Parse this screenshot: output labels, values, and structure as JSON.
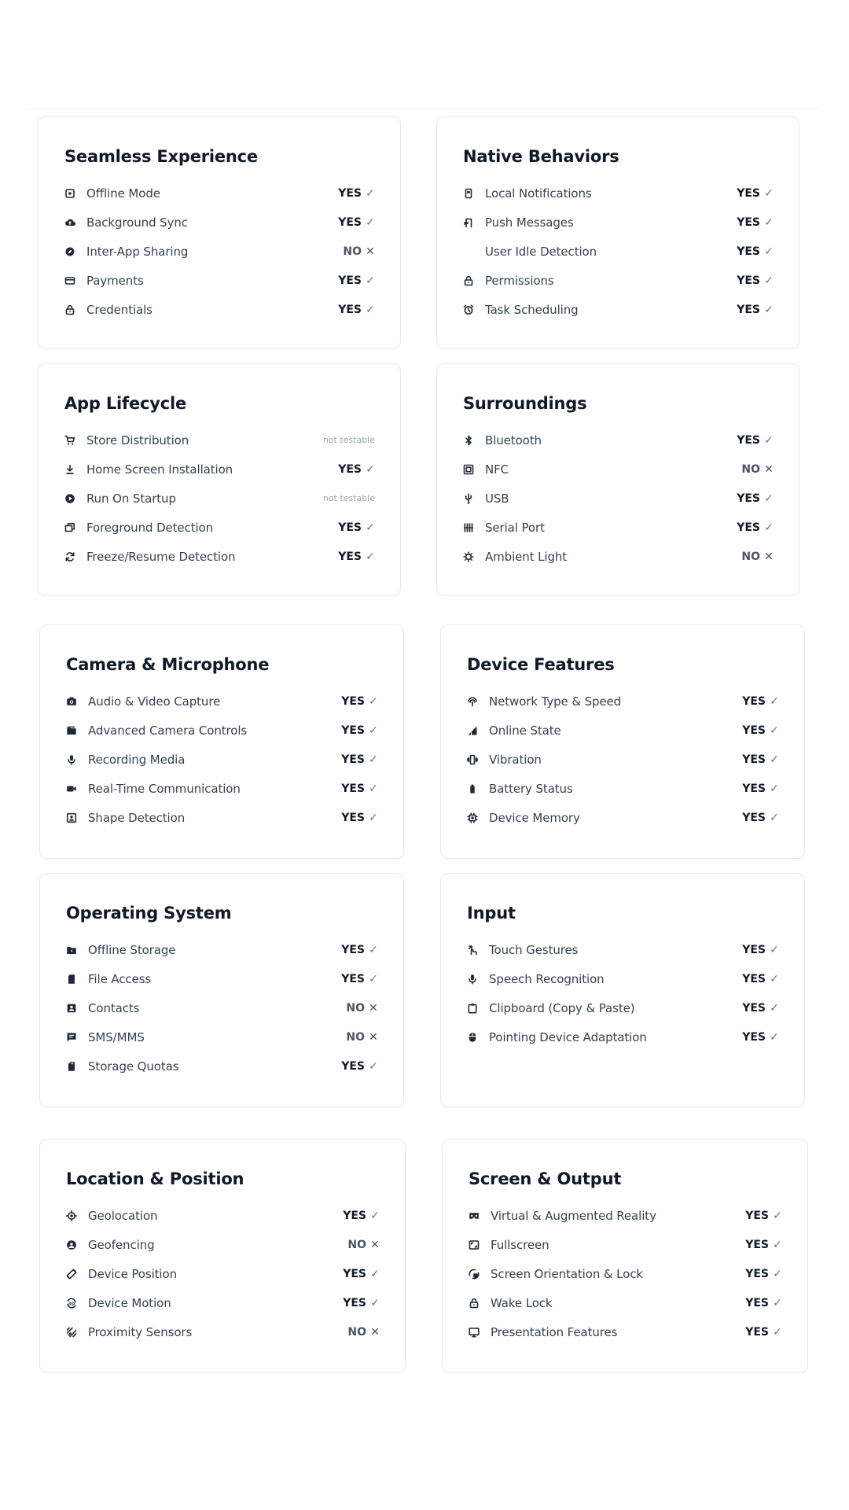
{
  "cards": [
    {
      "title": "Seamless Experience",
      "items": [
        {
          "label": "Offline Mode",
          "icon": "offline-mode-icon",
          "status": "YES",
          "mark": "✓"
        },
        {
          "label": "Background Sync",
          "icon": "cloud-sync-icon",
          "status": "YES",
          "mark": "✓"
        },
        {
          "label": "Inter-App Sharing",
          "icon": "share-compass-icon",
          "status": "NO",
          "mark": "✕"
        },
        {
          "label": "Payments",
          "icon": "credit-card-icon",
          "status": "YES",
          "mark": "✓"
        },
        {
          "label": "Credentials",
          "icon": "lock-icon",
          "status": "YES",
          "mark": "✓"
        }
      ]
    },
    {
      "title": "Native Behaviors",
      "items": [
        {
          "label": "Local Notifications",
          "icon": "phone-notification-icon",
          "status": "YES",
          "mark": "✓"
        },
        {
          "label": "Push Messages",
          "icon": "push-message-icon",
          "status": "YES",
          "mark": "✓"
        },
        {
          "label": "User Idle Detection",
          "icon": "moon-icon",
          "status": "YES",
          "mark": "✓"
        },
        {
          "label": "Permissions",
          "icon": "lock-icon",
          "status": "YES",
          "mark": "✓"
        },
        {
          "label": "Task Scheduling",
          "icon": "alarm-clock-icon",
          "status": "YES",
          "mark": "✓"
        }
      ]
    },
    {
      "title": "App Lifecycle",
      "items": [
        {
          "label": "Store Distribution",
          "icon": "shopping-cart-icon",
          "status": "not testable",
          "mark": ""
        },
        {
          "label": "Home Screen Installation",
          "icon": "download-icon",
          "status": "YES",
          "mark": "✓"
        },
        {
          "label": "Run On Startup",
          "icon": "startup-gear-icon",
          "status": "not testable",
          "mark": ""
        },
        {
          "label": "Foreground Detection",
          "icon": "foreground-window-icon",
          "status": "YES",
          "mark": "✓"
        },
        {
          "label": "Freeze/Resume Detection",
          "icon": "refresh-icon",
          "status": "YES",
          "mark": "✓"
        }
      ]
    },
    {
      "title": "Surroundings",
      "items": [
        {
          "label": "Bluetooth",
          "icon": "bluetooth-icon",
          "status": "YES",
          "mark": "✓"
        },
        {
          "label": "NFC",
          "icon": "nfc-icon",
          "status": "NO",
          "mark": "✕"
        },
        {
          "label": "USB",
          "icon": "usb-icon",
          "status": "YES",
          "mark": "✓"
        },
        {
          "label": "Serial Port",
          "icon": "serial-port-icon",
          "status": "YES",
          "mark": "✓"
        },
        {
          "label": "Ambient Light",
          "icon": "light-sun-icon",
          "status": "NO",
          "mark": "✕"
        }
      ]
    },
    {
      "title": "Camera & Microphone",
      "items": [
        {
          "label": "Audio & Video Capture",
          "icon": "camera-icon",
          "status": "YES",
          "mark": "✓"
        },
        {
          "label": "Advanced Camera Controls",
          "icon": "camera-controls-icon",
          "status": "YES",
          "mark": "✓"
        },
        {
          "label": "Recording Media",
          "icon": "microphone-icon",
          "status": "YES",
          "mark": "✓"
        },
        {
          "label": "Real-Time Communication",
          "icon": "video-camera-icon",
          "status": "YES",
          "mark": "✓"
        },
        {
          "label": "Shape Detection",
          "icon": "face-frame-icon",
          "status": "YES",
          "mark": "✓"
        }
      ]
    },
    {
      "title": "Device Features",
      "items": [
        {
          "label": "Network Type & Speed",
          "icon": "network-signal-icon",
          "status": "YES",
          "mark": "✓"
        },
        {
          "label": "Online State",
          "icon": "cell-signal-icon",
          "status": "YES",
          "mark": "✓"
        },
        {
          "label": "Vibration",
          "icon": "vibration-icon",
          "status": "YES",
          "mark": "✓"
        },
        {
          "label": "Battery Status",
          "icon": "battery-icon",
          "status": "YES",
          "mark": "✓"
        },
        {
          "label": "Device Memory",
          "icon": "memory-chip-icon",
          "status": "YES",
          "mark": "✓"
        }
      ]
    },
    {
      "title": "Operating System",
      "items": [
        {
          "label": "Offline Storage",
          "icon": "storage-folder-icon",
          "status": "YES",
          "mark": "✓"
        },
        {
          "label": "File Access",
          "icon": "file-icon",
          "status": "YES",
          "mark": "✓"
        },
        {
          "label": "Contacts",
          "icon": "contact-card-icon",
          "status": "NO",
          "mark": "✕"
        },
        {
          "label": "SMS/MMS",
          "icon": "message-icon",
          "status": "NO",
          "mark": "✕"
        },
        {
          "label": "Storage Quotas",
          "icon": "sd-card-icon",
          "status": "YES",
          "mark": "✓"
        }
      ]
    },
    {
      "title": "Input",
      "items": [
        {
          "label": "Touch Gestures",
          "icon": "touch-gesture-icon",
          "status": "YES",
          "mark": "✓"
        },
        {
          "label": "Speech Recognition",
          "icon": "microphone-icon",
          "status": "YES",
          "mark": "✓"
        },
        {
          "label": "Clipboard (Copy & Paste)",
          "icon": "clipboard-icon",
          "status": "YES",
          "mark": "✓"
        },
        {
          "label": "Pointing Device Adaptation",
          "icon": "mouse-icon",
          "status": "YES",
          "mark": "✓"
        }
      ]
    },
    {
      "title": "Location & Position",
      "items": [
        {
          "label": "Geolocation",
          "icon": "location-target-icon",
          "status": "YES",
          "mark": "✓"
        },
        {
          "label": "Geofencing",
          "icon": "geofence-icon",
          "status": "NO",
          "mark": "✕"
        },
        {
          "label": "Device Position",
          "icon": "screen-rotation-icon",
          "status": "YES",
          "mark": "✓"
        },
        {
          "label": "Device Motion",
          "icon": "motion-3d-icon",
          "status": "YES",
          "mark": "✓"
        },
        {
          "label": "Proximity Sensors",
          "icon": "proximity-icon",
          "status": "NO",
          "mark": "✕"
        }
      ]
    },
    {
      "title": "Screen & Output",
      "items": [
        {
          "label": "Virtual & Augmented Reality",
          "icon": "vr-headset-icon",
          "status": "YES",
          "mark": "✓"
        },
        {
          "label": "Fullscreen",
          "icon": "fullscreen-icon",
          "status": "YES",
          "mark": "✓"
        },
        {
          "label": "Screen Orientation & Lock",
          "icon": "screen-lock-rotation-icon",
          "status": "YES",
          "mark": "✓"
        },
        {
          "label": "Wake Lock",
          "icon": "lock-icon",
          "status": "YES",
          "mark": "✓"
        },
        {
          "label": "Presentation Features",
          "icon": "monitor-icon",
          "status": "YES",
          "mark": "✓"
        }
      ]
    }
  ]
}
